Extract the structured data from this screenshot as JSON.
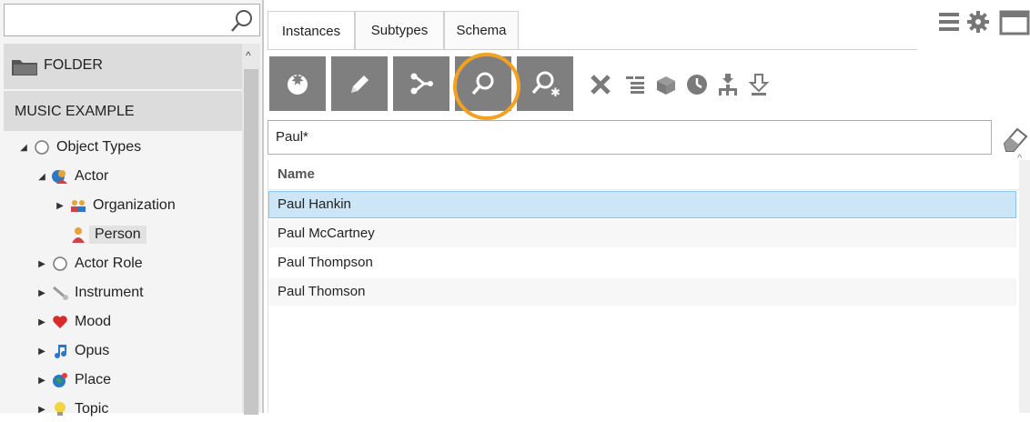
{
  "left": {
    "search": {
      "value": "",
      "placeholder": ""
    },
    "folder_label": "FOLDER",
    "music_label": "MUSIC EXAMPLE",
    "tree": [
      {
        "label": "Object Types",
        "expand": "expanded",
        "icon": "circle-icon",
        "indent": 0
      },
      {
        "label": "Actor",
        "expand": "expanded",
        "icon": "actor-icon",
        "indent": 1
      },
      {
        "label": "Organization",
        "expand": "collapsed",
        "icon": "organization-icon",
        "indent": 2
      },
      {
        "label": "Person",
        "expand": "none",
        "icon": "person-icon",
        "indent": 2,
        "selected": true
      },
      {
        "label": "Actor Role",
        "expand": "collapsed",
        "icon": "circle-icon",
        "indent": 1
      },
      {
        "label": "Instrument",
        "expand": "collapsed",
        "icon": "instrument-icon",
        "indent": 1
      },
      {
        "label": "Mood",
        "expand": "collapsed",
        "icon": "heart-icon",
        "indent": 1
      },
      {
        "label": "Opus",
        "expand": "collapsed",
        "icon": "music-note-icon",
        "indent": 1
      },
      {
        "label": "Place",
        "expand": "collapsed",
        "icon": "globe-icon",
        "indent": 1
      },
      {
        "label": "Topic",
        "expand": "collapsed",
        "icon": "lightbulb-icon",
        "indent": 1
      }
    ]
  },
  "tabs": [
    {
      "label": "Instances",
      "active": true
    },
    {
      "label": "Subtypes",
      "active": false
    },
    {
      "label": "Schema",
      "active": false
    }
  ],
  "toolbar": {
    "buttons": [
      "new-instance-icon",
      "edit-icon",
      "graph-icon",
      "search-icon",
      "search-advanced-icon"
    ],
    "small_icons": [
      "delete-icon",
      "list-icon",
      "package-icon",
      "clock-icon",
      "hierarchy-import-icon",
      "export-icon"
    ]
  },
  "search": {
    "value": "Paul*"
  },
  "results": {
    "column": "Name",
    "rows": [
      "Paul Hankin",
      "Paul McCartney",
      "Paul Thompson",
      "Paul Thomson"
    ],
    "selected_index": 0
  },
  "colors": {
    "highlight": "#f4a020",
    "selection": "#cde6f7",
    "toolbar_button": "#7f7f7f"
  }
}
